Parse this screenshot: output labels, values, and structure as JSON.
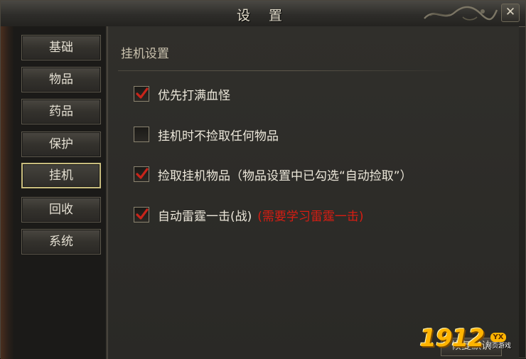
{
  "window": {
    "title": "设 置"
  },
  "sidebar": {
    "items": [
      {
        "label": "基础",
        "active": false
      },
      {
        "label": "物品",
        "active": false
      },
      {
        "label": "药品",
        "active": false
      },
      {
        "label": "保护",
        "active": false
      },
      {
        "label": "挂机",
        "active": true
      },
      {
        "label": "回收",
        "active": false
      },
      {
        "label": "系统",
        "active": false
      }
    ]
  },
  "main": {
    "section_title": "挂机设置",
    "options": [
      {
        "label": "优先打满血怪",
        "checked": true,
        "warning": ""
      },
      {
        "label": "挂机时不捡取任何物品",
        "checked": false,
        "warning": ""
      },
      {
        "label": "捡取挂机物品（物品设置中已勾选“自动捡取”）",
        "checked": true,
        "warning": ""
      },
      {
        "label": "自动雷霆一击(战)",
        "checked": true,
        "warning": "(需要学习雷霆一击)"
      }
    ],
    "corner_button_label": "恢复默认"
  },
  "watermark": {
    "number": "1912",
    "badge": "YX",
    "sub": "网页游戏"
  },
  "colors": {
    "checkmark": "#c8241a",
    "warning_text": "#d81d12",
    "active_border": "#c9bd7e",
    "watermark_gold": "#ffb400"
  },
  "icons": {
    "checkmark": "checkmark-icon",
    "close": "close-icon",
    "dragon": "dragon-ornament-icon"
  }
}
